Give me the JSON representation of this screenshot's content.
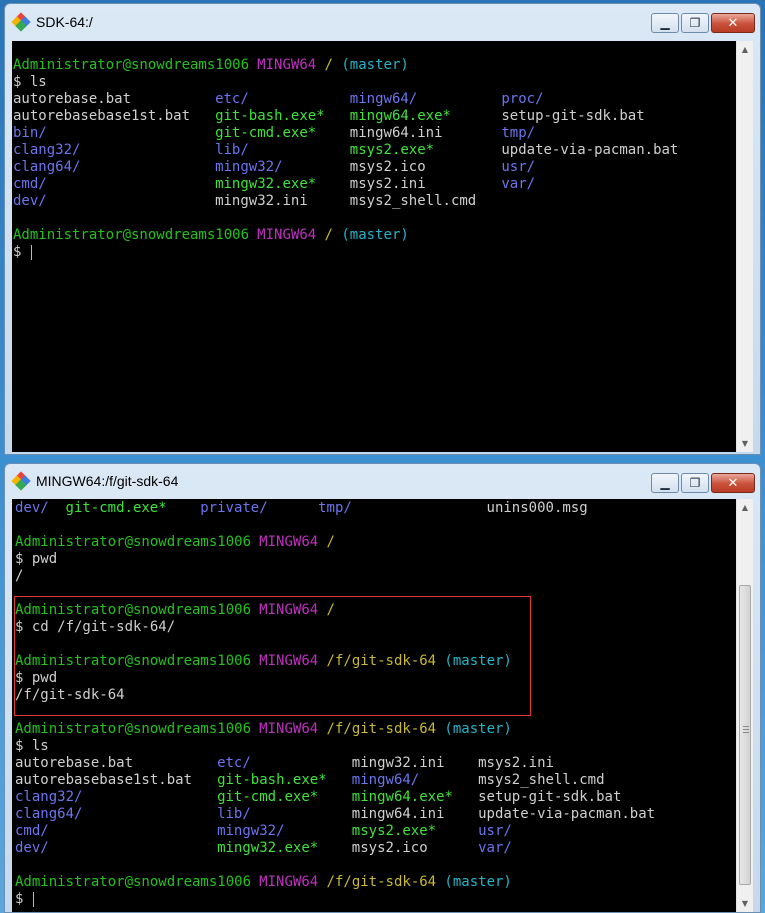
{
  "window_top": {
    "title": "SDK-64:/",
    "controls": {
      "minimize": "▁",
      "maximize": "❐",
      "close": "✕"
    },
    "lines": [
      [
        {
          "t": "Administrator@snowdreams1006",
          "c": "green"
        },
        {
          "t": " MINGW64",
          "c": "magenta"
        },
        {
          "t": " /",
          "c": "yellow"
        },
        {
          "t": " (master)",
          "c": "cyan"
        }
      ],
      [
        {
          "t": "$ ls",
          "c": "white"
        }
      ],
      [
        {
          "t": "autorebase.bat",
          "c": "white",
          "col": 0
        },
        {
          "t": "etc/",
          "c": "blue",
          "col": 24
        },
        {
          "t": "mingw64/",
          "c": "blue",
          "col": 40
        },
        {
          "t": "proc/",
          "c": "blue",
          "col": 58
        }
      ],
      [
        {
          "t": "autorebasebase1st.bat",
          "c": "white",
          "col": 0
        },
        {
          "t": "git-bash.exe*",
          "c": "bgreen",
          "col": 24
        },
        {
          "t": "mingw64.exe*",
          "c": "bgreen",
          "col": 40
        },
        {
          "t": "setup-git-sdk.bat",
          "c": "white",
          "col": 58
        }
      ],
      [
        {
          "t": "bin/",
          "c": "blue",
          "col": 0
        },
        {
          "t": "git-cmd.exe*",
          "c": "bgreen",
          "col": 24
        },
        {
          "t": "mingw64.ini",
          "c": "white",
          "col": 40
        },
        {
          "t": "tmp/",
          "c": "blue",
          "col": 58
        }
      ],
      [
        {
          "t": "clang32/",
          "c": "blue",
          "col": 0
        },
        {
          "t": "lib/",
          "c": "blue",
          "col": 24
        },
        {
          "t": "msys2.exe*",
          "c": "bgreen",
          "col": 40
        },
        {
          "t": "update-via-pacman.bat",
          "c": "white",
          "col": 58
        }
      ],
      [
        {
          "t": "clang64/",
          "c": "blue",
          "col": 0
        },
        {
          "t": "mingw32/",
          "c": "blue",
          "col": 24
        },
        {
          "t": "msys2.ico",
          "c": "white",
          "col": 40
        },
        {
          "t": "usr/",
          "c": "blue",
          "col": 58
        }
      ],
      [
        {
          "t": "cmd/",
          "c": "blue",
          "col": 0
        },
        {
          "t": "mingw32.exe*",
          "c": "bgreen",
          "col": 24
        },
        {
          "t": "msys2.ini",
          "c": "white",
          "col": 40
        },
        {
          "t": "var/",
          "c": "blue",
          "col": 58
        }
      ],
      [
        {
          "t": "dev/",
          "c": "blue",
          "col": 0
        },
        {
          "t": "mingw32.ini",
          "c": "white",
          "col": 24
        },
        {
          "t": "msys2_shell.cmd",
          "c": "white",
          "col": 40
        }
      ],
      [],
      [
        {
          "t": "Administrator@snowdreams1006",
          "c": "green"
        },
        {
          "t": " MINGW64",
          "c": "magenta"
        },
        {
          "t": " /",
          "c": "yellow"
        },
        {
          "t": " (master)",
          "c": "cyan"
        }
      ],
      [
        {
          "t": "$ ",
          "c": "white"
        }
      ]
    ]
  },
  "window_bottom": {
    "title": "MINGW64:/f/git-sdk-64",
    "controls": {
      "minimize": "▁",
      "maximize": "❐",
      "close": "✕"
    },
    "lines": [
      [
        {
          "t": "dev/",
          "c": "blue",
          "col": 0
        },
        {
          "t": "git-cmd.exe*",
          "c": "bgreen",
          "col": 6
        },
        {
          "t": "private/",
          "c": "blue",
          "col": 22
        },
        {
          "t": "tmp/",
          "c": "blue",
          "col": 36
        },
        {
          "t": "unins000.msg",
          "c": "white",
          "col": 56
        }
      ],
      [],
      [
        {
          "t": "Administrator@snowdreams1006",
          "c": "green"
        },
        {
          "t": " MINGW64",
          "c": "magenta"
        },
        {
          "t": " /",
          "c": "yellow"
        }
      ],
      [
        {
          "t": "$ pwd",
          "c": "white"
        }
      ],
      [
        {
          "t": "/",
          "c": "white"
        }
      ],
      [],
      [
        {
          "t": "Administrator@snowdreams1006",
          "c": "green"
        },
        {
          "t": " MINGW64",
          "c": "magenta"
        },
        {
          "t": " /",
          "c": "yellow"
        }
      ],
      [
        {
          "t": "$ cd /f/git-sdk-64/",
          "c": "white"
        }
      ],
      [],
      [
        {
          "t": "Administrator@snowdreams1006",
          "c": "green"
        },
        {
          "t": " MINGW64",
          "c": "magenta"
        },
        {
          "t": " /f/git-sdk-64",
          "c": "yellow"
        },
        {
          "t": " (master)",
          "c": "cyan"
        }
      ],
      [
        {
          "t": "$ pwd",
          "c": "white"
        }
      ],
      [
        {
          "t": "/f/git-sdk-64",
          "c": "white"
        }
      ],
      [],
      [
        {
          "t": "Administrator@snowdreams1006",
          "c": "green"
        },
        {
          "t": " MINGW64",
          "c": "magenta"
        },
        {
          "t": " /f/git-sdk-64",
          "c": "yellow"
        },
        {
          "t": " (master)",
          "c": "cyan"
        }
      ],
      [
        {
          "t": "$ ls",
          "c": "white"
        }
      ],
      [
        {
          "t": "autorebase.bat",
          "c": "white",
          "col": 0
        },
        {
          "t": "etc/",
          "c": "blue",
          "col": 24
        },
        {
          "t": "mingw32.ini",
          "c": "white",
          "col": 40
        },
        {
          "t": "msys2.ini",
          "c": "white",
          "col": 55
        }
      ],
      [
        {
          "t": "autorebasebase1st.bat",
          "c": "white",
          "col": 0
        },
        {
          "t": "git-bash.exe*",
          "c": "bgreen",
          "col": 24
        },
        {
          "t": "mingw64/",
          "c": "blue",
          "col": 40
        },
        {
          "t": "msys2_shell.cmd",
          "c": "white",
          "col": 55
        }
      ],
      [
        {
          "t": "clang32/",
          "c": "blue",
          "col": 0
        },
        {
          "t": "git-cmd.exe*",
          "c": "bgreen",
          "col": 24
        },
        {
          "t": "mingw64.exe*",
          "c": "bgreen",
          "col": 40
        },
        {
          "t": "setup-git-sdk.bat",
          "c": "white",
          "col": 55
        }
      ],
      [
        {
          "t": "clang64/",
          "c": "blue",
          "col": 0
        },
        {
          "t": "lib/",
          "c": "blue",
          "col": 24
        },
        {
          "t": "mingw64.ini",
          "c": "white",
          "col": 40
        },
        {
          "t": "update-via-pacman.bat",
          "c": "white",
          "col": 55
        }
      ],
      [
        {
          "t": "cmd/",
          "c": "blue",
          "col": 0
        },
        {
          "t": "mingw32/",
          "c": "blue",
          "col": 24
        },
        {
          "t": "msys2.exe*",
          "c": "bgreen",
          "col": 40
        },
        {
          "t": "usr/",
          "c": "blue",
          "col": 55
        }
      ],
      [
        {
          "t": "dev/",
          "c": "blue",
          "col": 0
        },
        {
          "t": "mingw32.exe*",
          "c": "bgreen",
          "col": 24
        },
        {
          "t": "msys2.ico",
          "c": "white",
          "col": 40
        },
        {
          "t": "var/",
          "c": "blue",
          "col": 55
        }
      ],
      [],
      [
        {
          "t": "Administrator@snowdreams1006",
          "c": "green"
        },
        {
          "t": " MINGW64",
          "c": "magenta"
        },
        {
          "t": " /f/git-sdk-64",
          "c": "yellow"
        },
        {
          "t": " (master)",
          "c": "cyan"
        }
      ],
      [
        {
          "t": "$ ",
          "c": "white"
        }
      ]
    ]
  },
  "colors": {
    "green": "#22c21b",
    "bgreen": "#3ee23a",
    "magenta": "#c02fc0",
    "yellow": "#c8b92e",
    "cyan": "#22b5c7",
    "blue": "#6c74ee",
    "white": "#cfcfcf",
    "highlight": "#e23a33"
  }
}
